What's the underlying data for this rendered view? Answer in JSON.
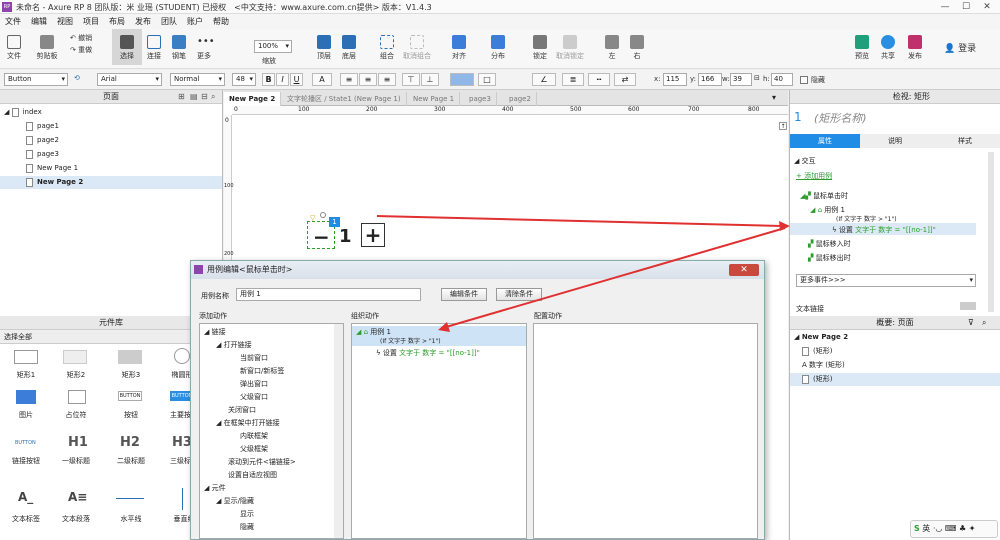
{
  "window": {
    "title": "未命名 - Axure RP 8 团队版：米 业瑶 (STUDENT) 已授权　<中文支持：www.axure.com.cn提供> 版本：V1.4.3",
    "logo": "RP",
    "min": "—",
    "max": "☐",
    "close": "✕"
  },
  "menu": [
    "文件",
    "编辑",
    "视图",
    "项目",
    "布局",
    "发布",
    "团队",
    "账户",
    "帮助"
  ],
  "toolbar": {
    "file": "文件",
    "clipboard": "剪贴板",
    "undo": "撤销",
    "redo": "重做",
    "select": "选择",
    "connect": "连接",
    "pen": "钢笔",
    "more": "更多",
    "zoom_value": "100%",
    "zoom": "缩放",
    "top": "顶层",
    "bottom": "底层",
    "group": "组合",
    "ungroup": "取消组合",
    "align": "对齐",
    "distribute": "分布",
    "lock": "锁定",
    "unlock": "取消锁定",
    "left": "左",
    "right": "右",
    "preview": "预览",
    "share": "共享",
    "publish": "发布",
    "login": "登录"
  },
  "format": {
    "widget_type": "Button",
    "font": "Arial",
    "style": "Normal",
    "size": "48",
    "bold": "B",
    "italic": "I",
    "underline": "U",
    "x_label": "x:",
    "x": "115",
    "y_label": "y:",
    "y": "166",
    "w_label": "w:",
    "w": "39",
    "h_label": "h:",
    "h": "40",
    "hidden": "隐藏"
  },
  "pages": {
    "header": "页面",
    "items": [
      {
        "label": "index"
      },
      {
        "label": "page1"
      },
      {
        "label": "page2"
      },
      {
        "label": "page3"
      },
      {
        "label": "New Page 1"
      },
      {
        "label": "New Page 2"
      }
    ]
  },
  "library": {
    "header": "元件库",
    "select_all": "选择全部",
    "row1": [
      "矩形1",
      "矩形2",
      "矩形3",
      "椭圆形"
    ],
    "row2": [
      "图片",
      "占位符",
      "按钮",
      "主要按钮"
    ],
    "row3": [
      "链接按钮",
      "一级标题",
      "二级标题",
      "三级标题"
    ],
    "row4": [
      "文本标签",
      "文本段落",
      "水平线",
      "垂直线"
    ],
    "btn_word": "BUTTON",
    "h1": "H1",
    "h2": "H2",
    "h3": "H3"
  },
  "tabs": [
    "New Page 2",
    "文字轮播区 / State1 (New Page 1)",
    "New Page 1",
    "page3",
    "page2"
  ],
  "ruler": [
    "0",
    "100",
    "200",
    "300",
    "400",
    "500",
    "600",
    "700",
    "800"
  ],
  "ruler_v": [
    "0",
    "100",
    "200"
  ],
  "canvas": {
    "minus": "−",
    "number": "1",
    "plus": "+",
    "badge": "1"
  },
  "inspector": {
    "header": "检视: 矩形",
    "index": "1",
    "name": "(矩形名称)",
    "tabs": [
      "属性",
      "说明",
      "样式"
    ],
    "interaction": "交互",
    "add_case": "添加用例",
    "onclick": "鼠标单击时",
    "case": "用例 1",
    "cond": "(If 文字于 数字 > \"1\")",
    "action_prefix": "设置",
    "action": "文字于 数字 = \"[[no-1]]\"",
    "onmouseenter": "鼠标移入时",
    "onmouseleave": "鼠标移出时",
    "more_events": "更多事件>>>",
    "text_link": "文本链接"
  },
  "outline": {
    "header": "概要: 页面",
    "page": "New Page 2",
    "items": [
      {
        "label": "(矩形)"
      },
      {
        "label": "数字 (矩形)"
      },
      {
        "label": "(矩形)"
      }
    ]
  },
  "dialog": {
    "title": "用例编辑<鼠标单击时>",
    "name_label": "用例名称",
    "name_value": "用例 1",
    "edit_cond": "编辑条件",
    "clear_cond": "清除条件",
    "add_action": "添加动作",
    "organize": "组织动作",
    "configure": "配置动作",
    "actions": [
      "链接",
      "打开链接",
      "当前窗口",
      "新窗口/新标签",
      "弹出窗口",
      "父级窗口",
      "关闭窗口",
      "在框架中打开链接",
      "内联框架",
      "父级框架",
      "滚动到元件<锚链接>",
      "设置自适应视图",
      "元件",
      "显示/隐藏",
      "显示",
      "隐藏"
    ],
    "case": "用例 1",
    "cond": "(If 文字于 数字 > \"1\")",
    "action_prefix": "设置",
    "action": "文字于 数字 = \"[[no-1]]\""
  },
  "colors": {
    "accent": "#1f8ce6",
    "arrow": "#e03030",
    "purple": "#8e44ad"
  }
}
